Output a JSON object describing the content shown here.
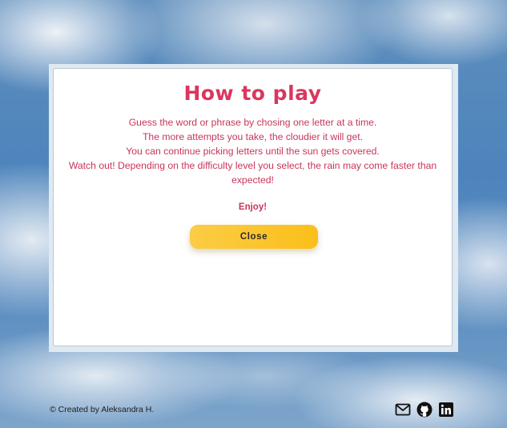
{
  "modal": {
    "title": "How to play",
    "instructions": [
      "Guess the word or phrase by chosing one letter at a time.",
      "The more attempts you take, the cloudier it will get.",
      "You can continue picking letters until the sun gets covered.",
      "Watch out! Depending on the difficulty level you select, the rain may come faster than expected!"
    ],
    "enjoy": "Enjoy!",
    "close_label": "Close"
  },
  "footer": {
    "credit": "© Created by Aleksandra H.",
    "social_icons": [
      "envelope-icon",
      "github-icon",
      "linkedin-icon"
    ]
  },
  "colors": {
    "title": "#d9375f",
    "text": "#c8355a",
    "button": "#fbc02d"
  }
}
